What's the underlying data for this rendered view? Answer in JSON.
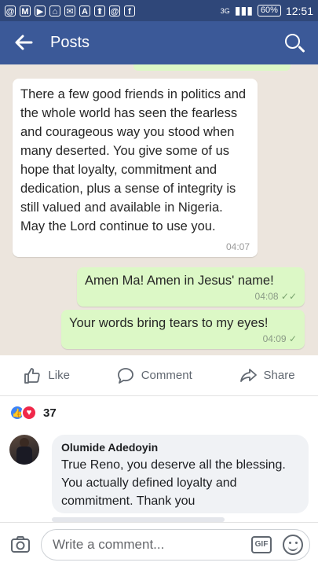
{
  "status_bar": {
    "time": "12:51",
    "battery": "60%",
    "network": "3G",
    "left_icons": [
      "@",
      "M",
      "▶",
      "⌂",
      "✉",
      "A",
      "⬆",
      "@",
      "f"
    ]
  },
  "header": {
    "title": "Posts"
  },
  "chat": {
    "incoming": {
      "text": "There a few good friends in politics and the whole world has seen the fearless and courageous way you stood when many deserted. You give some of us hope that loyalty, commitment and dedication, plus a sense of integrity is still valued and available in Nigeria. May the Lord continue to use you.",
      "time": "04:07"
    },
    "outgoing": [
      {
        "text": "Amen Ma! Amen in Jesus' name!",
        "time": "04:08",
        "status": "✓✓"
      },
      {
        "text": "Your words bring tears to my eyes!",
        "time": "04:09",
        "status": "✓"
      }
    ]
  },
  "actions": {
    "like": "Like",
    "comment": "Comment",
    "share": "Share"
  },
  "reactions": {
    "count": "37"
  },
  "comment": {
    "author": "Olumide Adedoyin",
    "text": "True Reno, you deserve all the blessing. You actually defined loyalty and commitment. Thank you"
  },
  "composer": {
    "placeholder": "Write a comment...",
    "gif_label": "GIF"
  },
  "colors": {
    "header": "#3b5998",
    "status_bar": "#2f4779",
    "chat_bg": "#ece5dd",
    "outgoing_bubble": "#dcf8c6"
  }
}
